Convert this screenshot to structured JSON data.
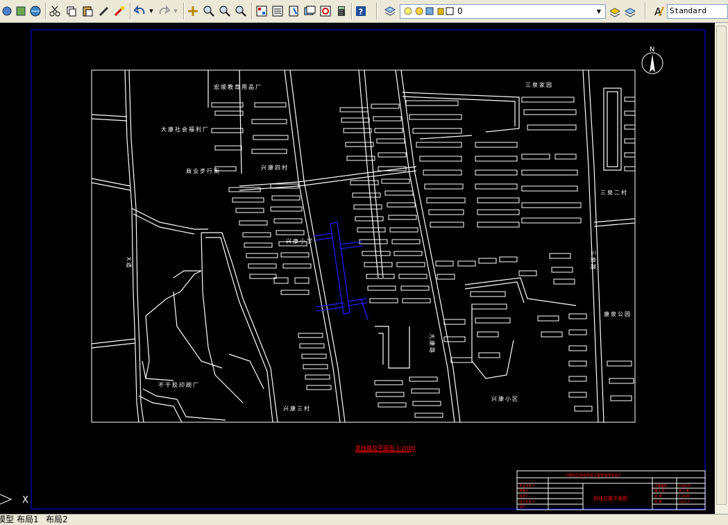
{
  "toolbar": {
    "layer_name": "0",
    "text_style": "Standard",
    "tools": [
      "zoom-extents-icon",
      "pan-icon",
      "orbit-icon",
      "cut-icon",
      "copy-icon",
      "paste-icon",
      "brush-icon",
      "match-properties-icon",
      "undo-icon",
      "redo-icon",
      "pan-realtime-icon",
      "zoom-realtime-icon",
      "zoom-window-icon",
      "zoom-previous-icon",
      "properties-icon",
      "design-center-icon",
      "tool-palettes-icon",
      "sheet-set-icon",
      "markup-icon",
      "calculator-icon",
      "help-icon"
    ]
  },
  "drawing": {
    "map_labels": {
      "l1": "宏顺教育用品厂",
      "l2": "大康社会福利厂",
      "l3": "商业步行街",
      "l4": "兴康四村",
      "l5": "三泉家园",
      "l6": "三泉二村",
      "l7": "兴康小区",
      "l8": "兴康三村",
      "l9": "兴康小学",
      "l10": "不干胶印刷厂",
      "l11": "康泉公园",
      "l12": "大康路",
      "l13": "三泉路",
      "l14": "X道"
    },
    "north": "N",
    "plan_title": "某线路及平面图 1:2000",
    "title_block": {
      "header": "兴康社区综合改造工程管线改造设计",
      "drawing_name": "管线位置平面图",
      "rows_left": [
        "专业负责人",
        "审核人",
        "校对人",
        "设计负责人",
        "设计",
        "制图"
      ],
      "rows_right": [
        "工程编号",
        "第 1 张",
        "比 例",
        "日 期"
      ],
      "values_right": [
        "GXSJ-01",
        "共 2 张",
        "1:2000",
        "2024.9"
      ]
    },
    "ucs": "X"
  },
  "tabs": [
    "模型",
    "布局1",
    "布局2"
  ],
  "colors": {
    "canvas": "#000000",
    "blue_frame": "#0000aa",
    "red_text": "#ff0000",
    "pipe": "#2020ff"
  }
}
